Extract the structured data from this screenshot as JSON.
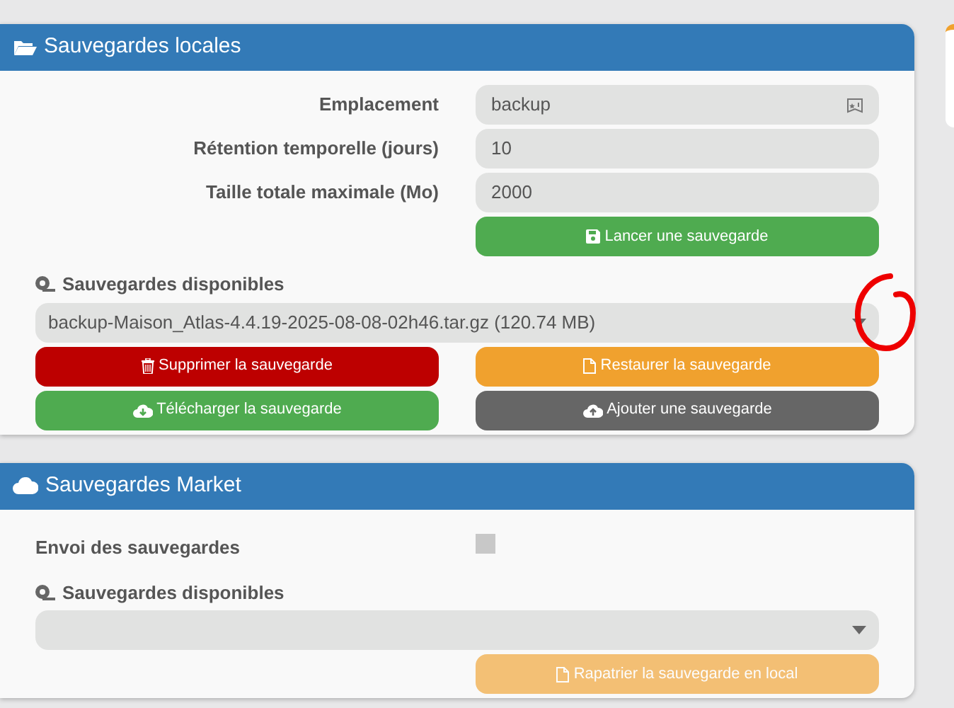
{
  "local": {
    "title": "Sauvegardes locales",
    "fields": [
      {
        "label": "Emplacement",
        "value": "backup",
        "kind": "tagged"
      },
      {
        "label": "Rétention temporelle (jours)",
        "value": "10",
        "kind": "plain"
      },
      {
        "label": "Taille totale maximale (Mo)",
        "value": "2000",
        "kind": "plain"
      }
    ],
    "launch_button": {
      "label": "Lancer une sauvegarde",
      "kind": "success"
    },
    "available": {
      "label": "Sauvegardes disponibles",
      "value": "backup-Maison_Atlas-4.4.19-2025-08-08-02h46.tar.gz (120.74 MB)"
    },
    "actions": [
      {
        "label": "Supprimer la sauvegarde",
        "kind": "danger"
      },
      {
        "label": "Restaurer la sauvegarde",
        "kind": "warning"
      },
      {
        "label": "Télécharger la sauvegarde",
        "kind": "success"
      },
      {
        "label": "Ajouter une sauvegarde",
        "kind": "dark"
      }
    ]
  },
  "market": {
    "title": "Sauvegardes Market",
    "send": {
      "label": "Envoi des sauvegardes",
      "checked": false
    },
    "available": {
      "label": "Sauvegardes disponibles"
    },
    "fetch_button": {
      "label": "Rapatrier la sauvegarde en local",
      "kind": "warning",
      "disabled": true
    }
  }
}
